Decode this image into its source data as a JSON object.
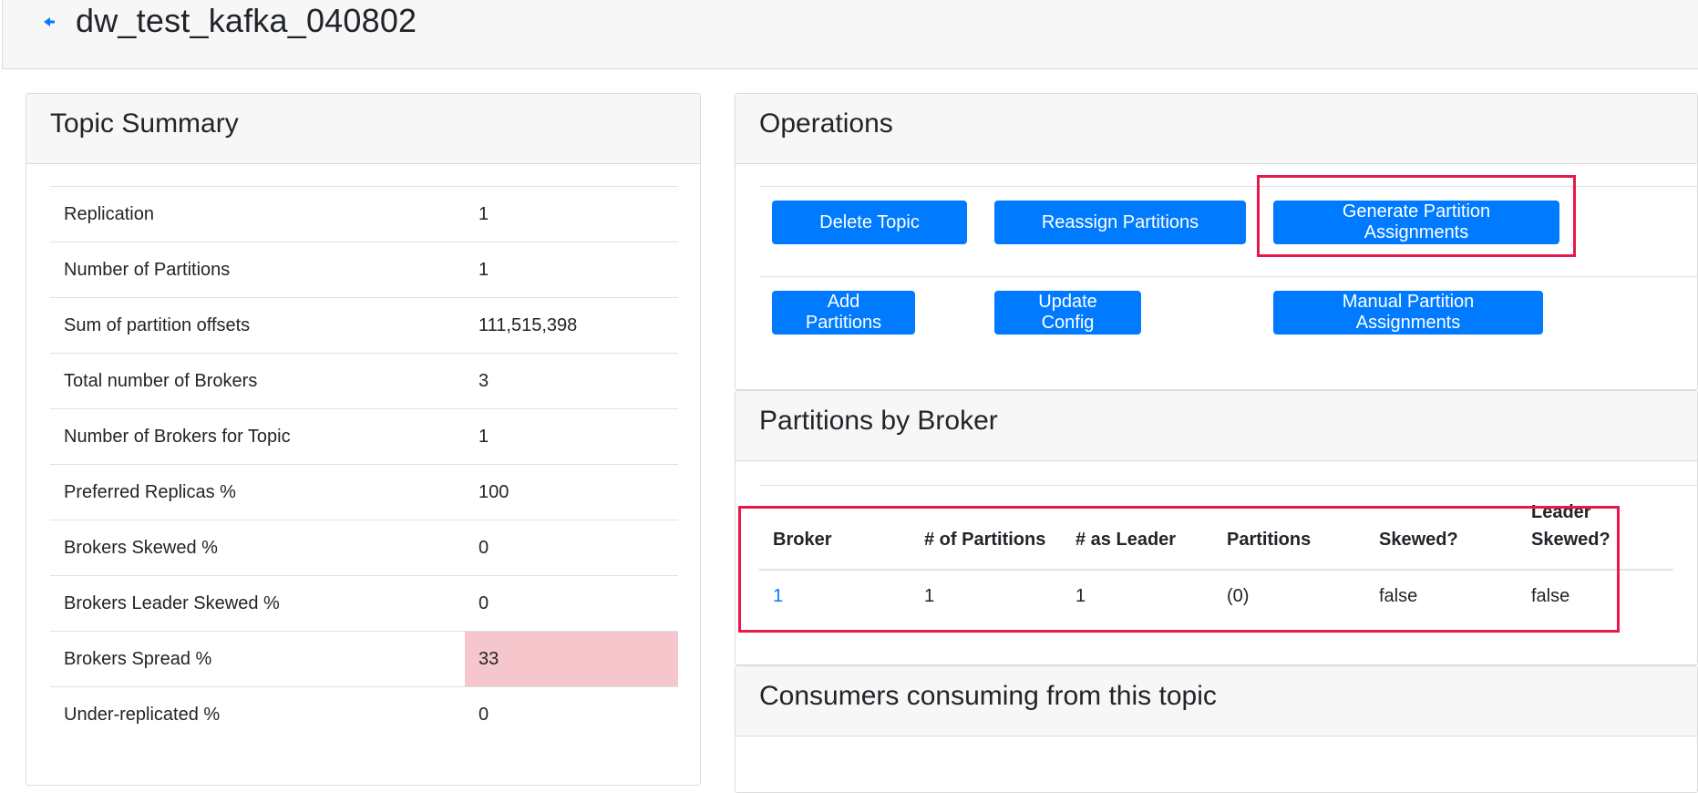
{
  "header": {
    "title": "dw_test_kafka_040802",
    "back_icon": "arrow-left-icon"
  },
  "summary": {
    "title": "Topic Summary",
    "rows": [
      {
        "label": "Replication",
        "value": "1"
      },
      {
        "label": "Number of Partitions",
        "value": "1"
      },
      {
        "label": "Sum of partition offsets",
        "value": "111,515,398"
      },
      {
        "label": "Total number of Brokers",
        "value": "3"
      },
      {
        "label": "Number of Brokers for Topic",
        "value": "1"
      },
      {
        "label": "Preferred Replicas %",
        "value": "100"
      },
      {
        "label": "Brokers Skewed %",
        "value": "0"
      },
      {
        "label": "Brokers Leader Skewed %",
        "value": "0"
      },
      {
        "label": "Brokers Spread %",
        "value": "33"
      },
      {
        "label": "Under-replicated %",
        "value": "0"
      }
    ],
    "danger_color": "#f5c6cb"
  },
  "operations": {
    "title": "Operations",
    "buttons": {
      "delete_topic": "Delete Topic",
      "reassign_partitions": "Reassign Partitions",
      "generate_assignments": "Generate Partition Assignments",
      "add_partitions": "Add Partitions",
      "update_config": "Update Config",
      "manual_assignments": "Manual Partition Assignments"
    },
    "button_color": "#007bff",
    "highlight_color": "#e8184c"
  },
  "partitions_by_broker": {
    "title": "Partitions by Broker",
    "columns": [
      "Broker",
      "# of Partitions",
      "# as Leader",
      "Partitions",
      "Skewed?",
      "Leader",
      "Skewed?"
    ],
    "rows": [
      {
        "broker": "1",
        "num_partitions": "1",
        "as_leader": "1",
        "partitions": "(0)",
        "skewed": "false",
        "leader_skewed": "false"
      }
    ]
  },
  "consumers": {
    "title": "Consumers consuming from this topic"
  }
}
